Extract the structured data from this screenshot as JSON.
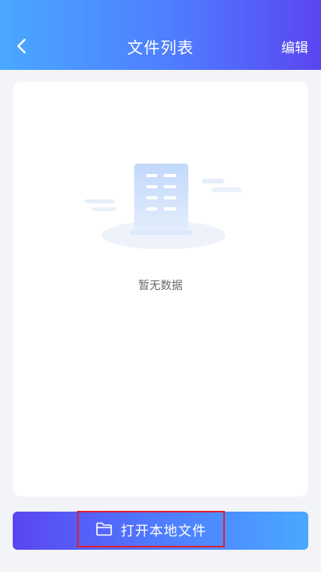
{
  "header": {
    "title": "文件列表",
    "edit_label": "编辑",
    "back_icon": "chevron-left-icon"
  },
  "empty_state": {
    "text": "暂无数据",
    "illustration": "document-empty-icon"
  },
  "bottom": {
    "open_button_label": "打开本地文件",
    "open_button_icon": "folder-icon",
    "highlight_color": "#e0202a"
  },
  "colors": {
    "gradient_start": "#4aa8ff",
    "gradient_end": "#5a45f0",
    "background": "#f3f4f8"
  }
}
